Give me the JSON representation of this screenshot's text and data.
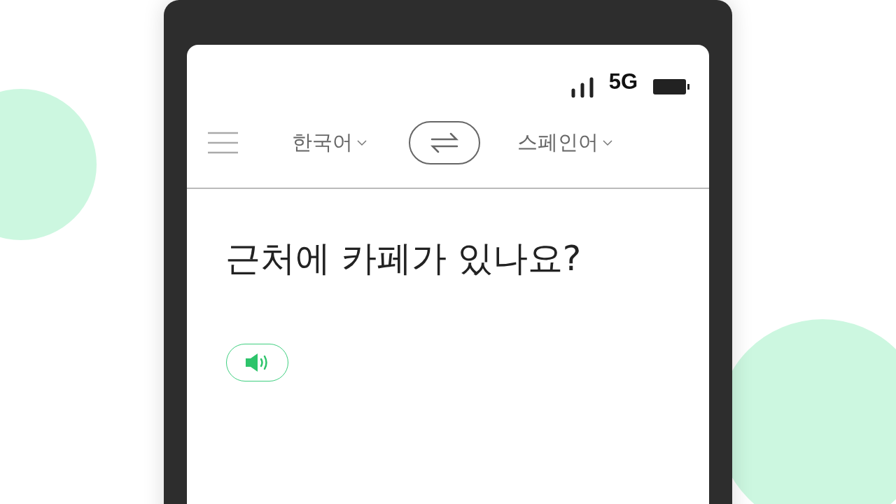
{
  "status_bar": {
    "network": "5G"
  },
  "language_bar": {
    "source_language": "한국어",
    "target_language": "스페인어"
  },
  "source_text": "근처에 카페가 있나요?"
}
